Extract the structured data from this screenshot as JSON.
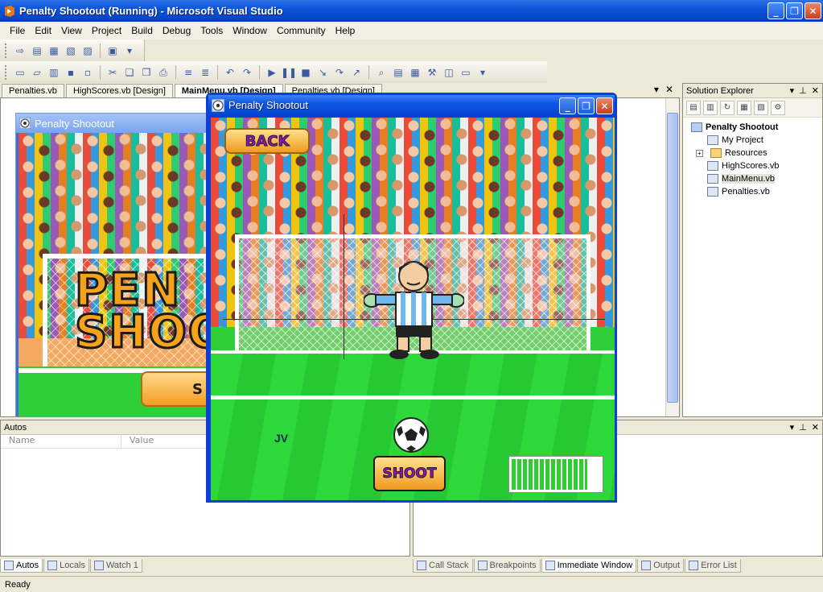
{
  "window": {
    "title": "Penalty Shootout (Running) - Microsoft Visual Studio",
    "minimize": "_",
    "maximize": "❐",
    "close": "✕"
  },
  "menu": [
    "File",
    "Edit",
    "View",
    "Project",
    "Build",
    "Debug",
    "Tools",
    "Window",
    "Community",
    "Help"
  ],
  "doc_tabs": [
    "Penalties.vb",
    "HighScores.vb [Design]",
    "MainMenu.vb [Design]",
    "Penalties.vb [Design]"
  ],
  "doc_tabs_active": 2,
  "design_form": {
    "title": "Penalty Shootout",
    "logo_line1": "PEN",
    "logo_line2": "SHOO",
    "button_partial": "S"
  },
  "solution_explorer": {
    "title": "Solution Explorer",
    "root": "Penalty Shootout",
    "items": [
      "My Project",
      "Resources",
      "HighScores.vb",
      "MainMenu.vb",
      "Penalties.vb"
    ],
    "selected": "MainMenu.vb"
  },
  "autos": {
    "title": "Autos",
    "col_name": "Name",
    "col_value": "Value"
  },
  "bottom_tabs_left": [
    "Autos",
    "Locals",
    "Watch 1"
  ],
  "bottom_tabs_right": [
    "Call Stack",
    "Breakpoints",
    "Immediate Window",
    "Output",
    "Error List"
  ],
  "status": "Ready",
  "game": {
    "title": "Penalty Shootout",
    "back_label": "BACK",
    "player_initials": "JV",
    "shoot_label": "SHOOT",
    "power_level": 0.85
  },
  "colors": {
    "xp_blue": "#0a3fd8",
    "grass": "#2fcf39",
    "button_orange": "#f09a1e",
    "button_text": "#9a10c7"
  }
}
